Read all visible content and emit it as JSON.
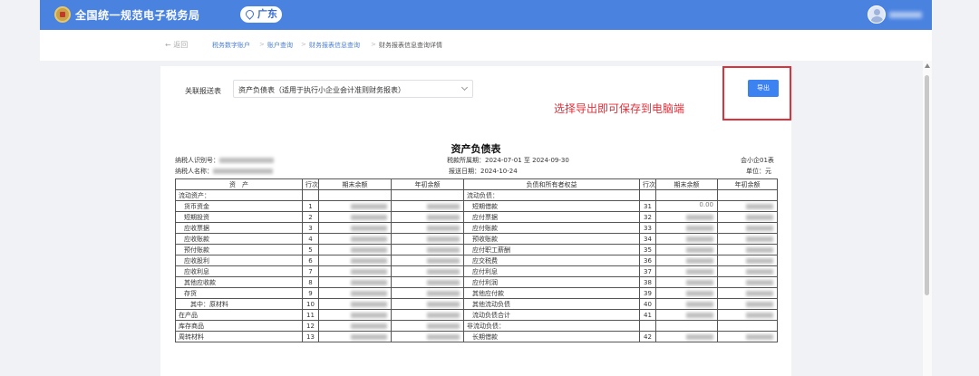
{
  "header": {
    "site_title": "全国统一规范电子税务局",
    "region": "广东",
    "emblem_icon": "tax-bureau-emblem-icon",
    "avatar_icon": "user-avatar-icon",
    "bg_color": "#4a82e0"
  },
  "breadcrumb": {
    "back": "← 返回",
    "items": [
      "税务数字账户",
      "账户查询",
      "财务报表信息查询",
      "财务报表信息查询详情"
    ],
    "separator": ">"
  },
  "controls": {
    "report_label": "关联报送表",
    "report_value": "资产负债表（适用于执行小企业会计准则财务报表）",
    "export_label": "导出",
    "export_color": "#3c82f0"
  },
  "annotation": {
    "text": "选择导出即可保存到电脑端",
    "color": "#e0303a"
  },
  "report": {
    "title": "资产负债表",
    "taxpayer_id_label": "纳税人识别号：",
    "taxpayer_name_label": "纳税人名称：",
    "period": "税款所属期：2024-07-01 至 2024-09-30",
    "submit_date": "报送日期：2024-10-24",
    "form_code": "会小企01表",
    "unit": "单位：元",
    "columns": [
      "资　产",
      "行次",
      "期末余额",
      "年初余额",
      "负债和所有者权益",
      "行次",
      "期末余额",
      "年初余额"
    ],
    "rows": [
      {
        "left": "流动资产：",
        "left_no": "",
        "left_indent": 0,
        "right": "流动负债：",
        "right_no": "",
        "right_indent": 0,
        "left_amt": false,
        "right_amt": false
      },
      {
        "left": "货币资金",
        "left_no": "1",
        "left_indent": 1,
        "right": "短期借款",
        "right_no": "31",
        "right_indent": 1,
        "left_amt": true,
        "right_amt": true,
        "right_end_value": "0.00"
      },
      {
        "left": "短期投资",
        "left_no": "2",
        "left_indent": 1,
        "right": "应付票据",
        "right_no": "32",
        "right_indent": 1,
        "left_amt": true,
        "right_amt": true
      },
      {
        "left": "应收票据",
        "left_no": "3",
        "left_indent": 1,
        "right": "应付账款",
        "right_no": "33",
        "right_indent": 1,
        "left_amt": true,
        "right_amt": true
      },
      {
        "left": "应收账款",
        "left_no": "4",
        "left_indent": 1,
        "right": "预收账款",
        "right_no": "34",
        "right_indent": 1,
        "left_amt": true,
        "right_amt": true
      },
      {
        "left": "预付账款",
        "left_no": "5",
        "left_indent": 1,
        "right": "应付职工薪酬",
        "right_no": "35",
        "right_indent": 1,
        "left_amt": true,
        "right_amt": true
      },
      {
        "left": "应收股利",
        "left_no": "6",
        "left_indent": 1,
        "right": "应交税费",
        "right_no": "36",
        "right_indent": 1,
        "left_amt": true,
        "right_amt": true
      },
      {
        "left": "应收利息",
        "left_no": "7",
        "left_indent": 1,
        "right": "应付利息",
        "right_no": "37",
        "right_indent": 1,
        "left_amt": true,
        "right_amt": true
      },
      {
        "left": "其他应收款",
        "left_no": "8",
        "left_indent": 1,
        "right": "应付利润",
        "right_no": "38",
        "right_indent": 1,
        "left_amt": true,
        "right_amt": true
      },
      {
        "left": "存货",
        "left_no": "9",
        "left_indent": 1,
        "right": "其他应付款",
        "right_no": "39",
        "right_indent": 1,
        "left_amt": true,
        "right_amt": true
      },
      {
        "left": "其中：原材料",
        "left_no": "10",
        "left_indent": 2,
        "right": "其他流动负债",
        "right_no": "40",
        "right_indent": 1,
        "left_amt": true,
        "right_amt": true
      },
      {
        "left": "在产品",
        "left_no": "11",
        "left_indent": 0,
        "right": "流动负债合计",
        "right_no": "41",
        "right_indent": 1,
        "left_amt": true,
        "right_amt": true
      },
      {
        "left": "库存商品",
        "left_no": "12",
        "left_indent": 0,
        "right": "非流动负债：",
        "right_no": "",
        "right_indent": 0,
        "left_amt": true,
        "right_amt": false
      },
      {
        "left": "周转材料",
        "left_no": "13",
        "left_indent": 0,
        "right": "长期借款",
        "right_no": "42",
        "right_indent": 1,
        "left_amt": true,
        "right_amt": true
      }
    ]
  }
}
